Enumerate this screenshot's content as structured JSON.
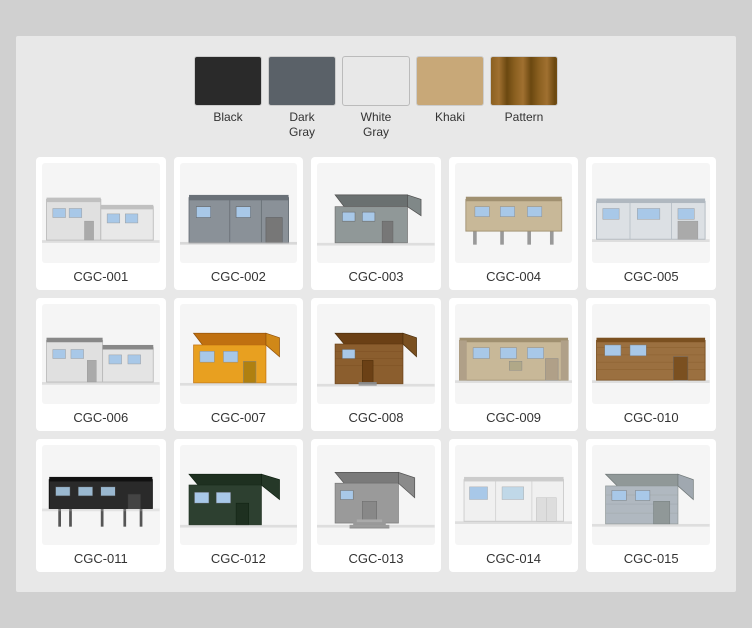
{
  "swatches": [
    {
      "id": "black",
      "label": "Black",
      "color": "#2a2a2a"
    },
    {
      "id": "dark-gray",
      "label": "Dark\nGray",
      "color": "#5a6168"
    },
    {
      "id": "white-gray",
      "label": "White\nGray",
      "color": "#e0e0e0",
      "border": true
    },
    {
      "id": "khaki",
      "label": "Khaki",
      "color": "#c8a878"
    },
    {
      "id": "pattern",
      "label": "Pattern",
      "color": "#8b6020",
      "pattern": true
    }
  ],
  "products": [
    {
      "id": "CGC-001",
      "label": "CGC-001",
      "color": "white",
      "variant": 1
    },
    {
      "id": "CGC-002",
      "label": "CGC-002",
      "color": "gray",
      "variant": 2
    },
    {
      "id": "CGC-003",
      "label": "CGC-003",
      "color": "dark-gray",
      "variant": 3
    },
    {
      "id": "CGC-004",
      "label": "CGC-004",
      "color": "tan",
      "variant": 4
    },
    {
      "id": "CGC-005",
      "label": "CGC-005",
      "color": "white",
      "variant": 5
    },
    {
      "id": "CGC-006",
      "label": "CGC-006",
      "color": "white",
      "variant": 6
    },
    {
      "id": "CGC-007",
      "label": "CGC-007",
      "color": "orange",
      "variant": 7
    },
    {
      "id": "CGC-008",
      "label": "CGC-008",
      "color": "wood",
      "variant": 8
    },
    {
      "id": "CGC-009",
      "label": "CGC-009",
      "color": "tan",
      "variant": 9
    },
    {
      "id": "CGC-010",
      "label": "CGC-010",
      "color": "brown",
      "variant": 10
    },
    {
      "id": "CGC-011",
      "label": "CGC-011",
      "color": "black",
      "variant": 11
    },
    {
      "id": "CGC-012",
      "label": "CGC-012",
      "color": "dark-green",
      "variant": 12
    },
    {
      "id": "CGC-013",
      "label": "CGC-013",
      "color": "gray",
      "variant": 13
    },
    {
      "id": "CGC-014",
      "label": "CGC-014",
      "color": "white",
      "variant": 14
    },
    {
      "id": "CGC-015",
      "label": "CGC-015",
      "color": "silver",
      "variant": 15
    }
  ]
}
